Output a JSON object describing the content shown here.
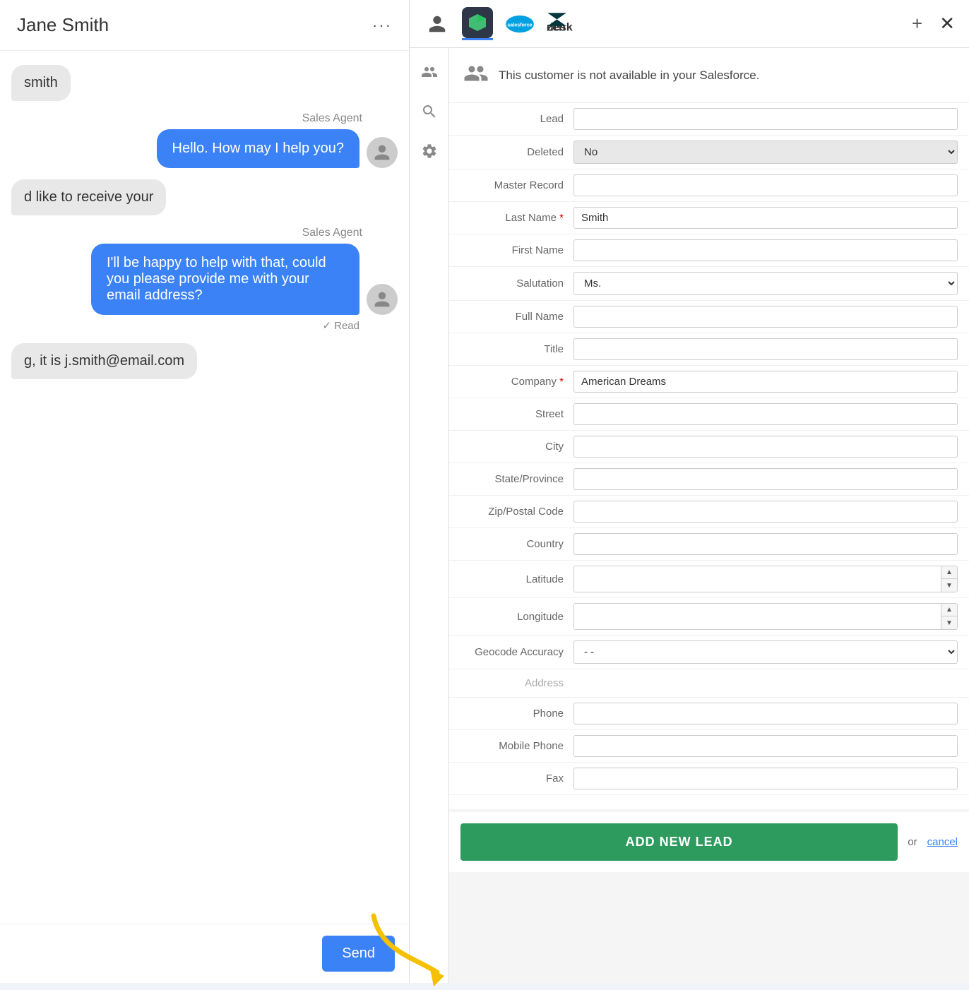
{
  "chat": {
    "header": {
      "title": "Jane Smith",
      "dots": "···"
    },
    "messages": [
      {
        "type": "customer",
        "text": "smith",
        "partial": true
      },
      {
        "type": "agent",
        "label": "Sales Agent",
        "text": "Hello. How may I help you?"
      },
      {
        "type": "customer",
        "text": "d like to receive your"
      },
      {
        "type": "agent",
        "label": "Sales Agent",
        "text": "I'll be happy to help with that, could you please provide me with your email address?",
        "status": "✓ Read"
      },
      {
        "type": "customer",
        "text": "g, it is j.smith@email.com"
      }
    ],
    "send_button": "Send"
  },
  "toolbar": {
    "add_label": "+",
    "close_label": "✕",
    "salesforce_active": true
  },
  "salesforce": {
    "notice": "This customer is not available in your Salesforce.",
    "form_fields": [
      {
        "label": "Lead",
        "type": "text",
        "value": "",
        "required": false
      },
      {
        "label": "Deleted",
        "type": "select",
        "value": "No",
        "required": false
      },
      {
        "label": "Master Record",
        "type": "text",
        "value": "",
        "required": false
      },
      {
        "label": "Last Name",
        "type": "text",
        "value": "Smith",
        "required": true
      },
      {
        "label": "First Name",
        "type": "text",
        "value": "",
        "required": false
      },
      {
        "label": "Salutation",
        "type": "select",
        "value": "Ms.",
        "required": false
      },
      {
        "label": "Full Name",
        "type": "text",
        "value": "",
        "required": false
      },
      {
        "label": "Title",
        "type": "text",
        "value": "",
        "required": false
      },
      {
        "label": "Company",
        "type": "text",
        "value": "American Dreams",
        "required": true
      },
      {
        "label": "Street",
        "type": "text",
        "value": "",
        "required": false
      },
      {
        "label": "City",
        "type": "text",
        "value": "",
        "required": false
      },
      {
        "label": "State/Province",
        "type": "text",
        "value": "",
        "required": false
      },
      {
        "label": "Zip/Postal Code",
        "type": "text",
        "value": "",
        "required": false
      },
      {
        "label": "Country",
        "type": "text",
        "value": "",
        "required": false
      },
      {
        "label": "Latitude",
        "type": "spinner",
        "value": "",
        "required": false
      },
      {
        "label": "Longitude",
        "type": "spinner",
        "value": "",
        "required": false
      },
      {
        "label": "Geocode Accuracy",
        "type": "select",
        "value": "- -",
        "required": false
      },
      {
        "label": "Address",
        "type": "label_only",
        "value": "",
        "required": false
      },
      {
        "label": "Phone",
        "type": "text",
        "value": "",
        "required": false
      },
      {
        "label": "Mobile Phone",
        "type": "text",
        "value": "",
        "required": false
      },
      {
        "label": "Fax",
        "type": "text",
        "value": "",
        "required": false
      }
    ],
    "add_lead_button": "ADD NEW LEAD",
    "or_text": "or",
    "cancel_link": "cancel"
  }
}
